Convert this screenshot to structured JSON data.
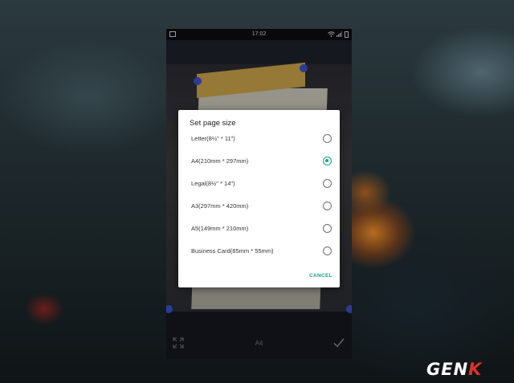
{
  "status_bar": {
    "time": "17:02"
  },
  "dialog": {
    "title": "Set page size",
    "options": [
      {
        "label": "Letter(8½\" * 11\")",
        "selected": false
      },
      {
        "label": "A4(210mm * 297mm)",
        "selected": true
      },
      {
        "label": "Legal(8½\" * 14\")",
        "selected": false
      },
      {
        "label": "A3(297mm * 420mm)",
        "selected": false
      },
      {
        "label": "A5(149mm * 210mm)",
        "selected": false
      },
      {
        "label": "Business Card(85mm * 55mm)",
        "selected": false
      }
    ],
    "cancel_label": "CANCEL"
  },
  "bottom_bar": {
    "page_size": "A4"
  },
  "watermark": {
    "brand": "GEN",
    "brand_accent": "K"
  },
  "colors": {
    "accent": "#16a085",
    "handle": "#3b4fc4",
    "watermark_accent": "#e0322b"
  }
}
